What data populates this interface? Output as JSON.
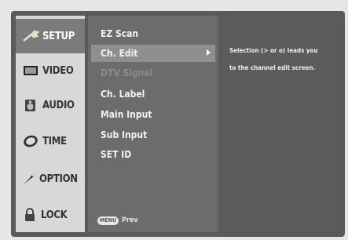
{
  "tabs": [
    {
      "label": "SETUP",
      "icon": "wrench-icon",
      "active": true
    },
    {
      "label": "VIDEO",
      "icon": "tv-icon",
      "active": false
    },
    {
      "label": "AUDIO",
      "icon": "speaker-icon",
      "active": false
    },
    {
      "label": "TIME",
      "icon": "clock-icon",
      "active": false
    },
    {
      "label": "OPTION",
      "icon": "option-icon",
      "active": false
    },
    {
      "label": "LOCK",
      "icon": "lock-icon",
      "active": false
    }
  ],
  "menu": {
    "items": [
      {
        "label": "EZ Scan",
        "state": "normal"
      },
      {
        "label": "Ch. Edit",
        "state": "selected"
      },
      {
        "label": "DTV Signal",
        "state": "disabled"
      },
      {
        "label": "Ch. Label",
        "state": "normal"
      },
      {
        "label": "Main Input",
        "state": "normal"
      },
      {
        "label": "Sub Input",
        "state": "normal"
      },
      {
        "label": "SET ID",
        "state": "normal"
      }
    ],
    "hint_key": "MENU",
    "hint_label": "Prev"
  },
  "help": {
    "line1": "Selection (> or o) leads you",
    "line2": "to the channel edit screen."
  },
  "colors": {
    "background": "#e6e6e6",
    "tab_column": "#d8d8d8",
    "active_tab": "#7b7b7b",
    "menu_panel": "#6c6c6c",
    "selected_item": "#8f8f8f",
    "help_panel": "#5c5c5c"
  }
}
